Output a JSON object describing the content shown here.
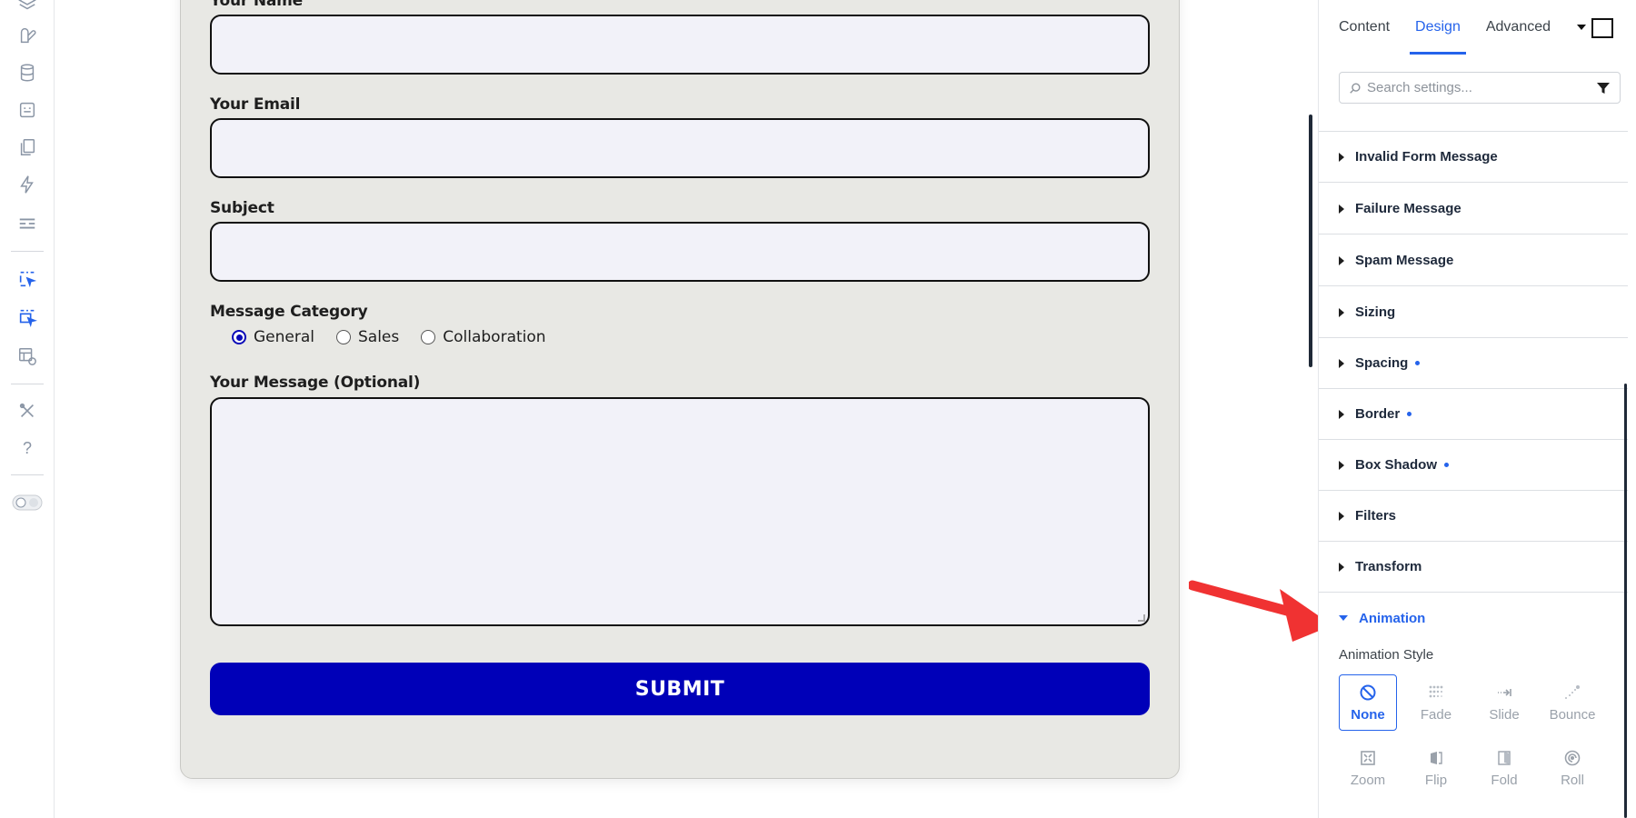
{
  "rail": {
    "icons": [
      "layers-icon",
      "brush-icon",
      "database-icon",
      "form-icon",
      "pages-icon",
      "lightning-icon",
      "template-icon",
      "cursor-select-icon",
      "cursor-multi-icon",
      "table-settings-icon",
      "tools-icon",
      "help-icon",
      "theme-toggle-icon"
    ],
    "help_glyph": "?"
  },
  "form": {
    "name_label": "Your Name",
    "email_label": "Your Email",
    "subject_label": "Subject",
    "category_label": "Message Category",
    "category_options": [
      "General",
      "Sales",
      "Collaboration"
    ],
    "category_selected": "General",
    "message_label": "Your Message (Optional)",
    "submit_label": "SUBMIT",
    "submit_color": "#0000b8",
    "card_color": "#e8e8e4"
  },
  "panel": {
    "tabs": [
      "Content",
      "Design",
      "Advanced"
    ],
    "active_tab": "Design",
    "search_placeholder": "Search settings...",
    "sections": [
      {
        "label": "Invalid Form Message",
        "modified": false
      },
      {
        "label": "Failure Message",
        "modified": false
      },
      {
        "label": "Spam Message",
        "modified": false
      },
      {
        "label": "Sizing",
        "modified": false
      },
      {
        "label": "Spacing",
        "modified": true
      },
      {
        "label": "Border",
        "modified": true
      },
      {
        "label": "Box Shadow",
        "modified": true
      },
      {
        "label": "Filters",
        "modified": false
      },
      {
        "label": "Transform",
        "modified": false
      },
      {
        "label": "Animation",
        "modified": false,
        "expanded": true
      }
    ],
    "animation_style_label": "Animation Style",
    "animation_styles": [
      "None",
      "Fade",
      "Slide",
      "Bounce",
      "Zoom",
      "Flip",
      "Fold",
      "Roll"
    ],
    "animation_selected": "None",
    "accent": "#2563eb"
  },
  "annotation": {
    "arrow_color": "#f03232"
  }
}
